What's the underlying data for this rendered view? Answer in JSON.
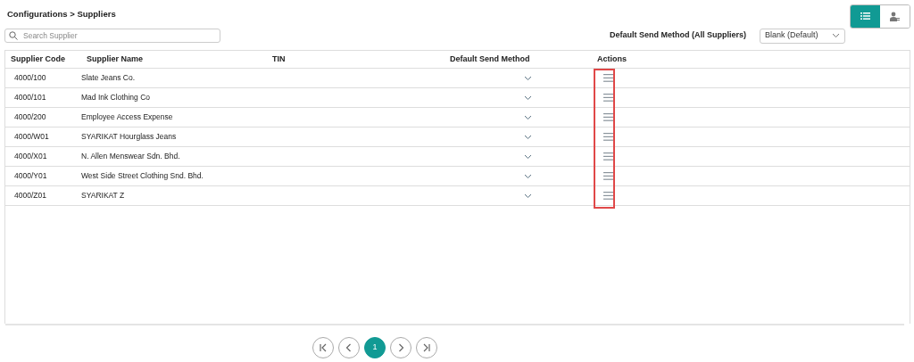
{
  "breadcrumb": "Configurations > Suppliers",
  "view_toggle": [
    {
      "kind": "list",
      "selected": true
    },
    {
      "kind": "person",
      "selected": false
    }
  ],
  "search": {
    "placeholder": "Search Supplier"
  },
  "default_send_method": {
    "label": "Default Send Method (All Suppliers)",
    "value": "Blank (Default)"
  },
  "table": {
    "columns": [
      "Supplier Code",
      "Supplier Name",
      "TIN",
      "Default Send Method",
      "Actions"
    ],
    "actions_highlighted": true,
    "rows": [
      {
        "code": "4000/100",
        "name": "Slate Jeans Co."
      },
      {
        "code": "4000/101",
        "name": "Mad Ink Clothing Co"
      },
      {
        "code": "4000/200",
        "name": "Employee Access Expense"
      },
      {
        "code": "4000/W01",
        "name": "SYARIKAT Hourglass Jeans"
      },
      {
        "code": "4000/X01",
        "name": "N. Allen Menswear Sdn. Bhd."
      },
      {
        "code": "4000/Y01",
        "name": "West Side Street Clothing Snd. Bhd."
      },
      {
        "code": "4000/Z01",
        "name": "SYARIKAT Z"
      }
    ]
  },
  "pagination": {
    "pages": [
      {
        "label": "1",
        "selected": true
      }
    ]
  }
}
